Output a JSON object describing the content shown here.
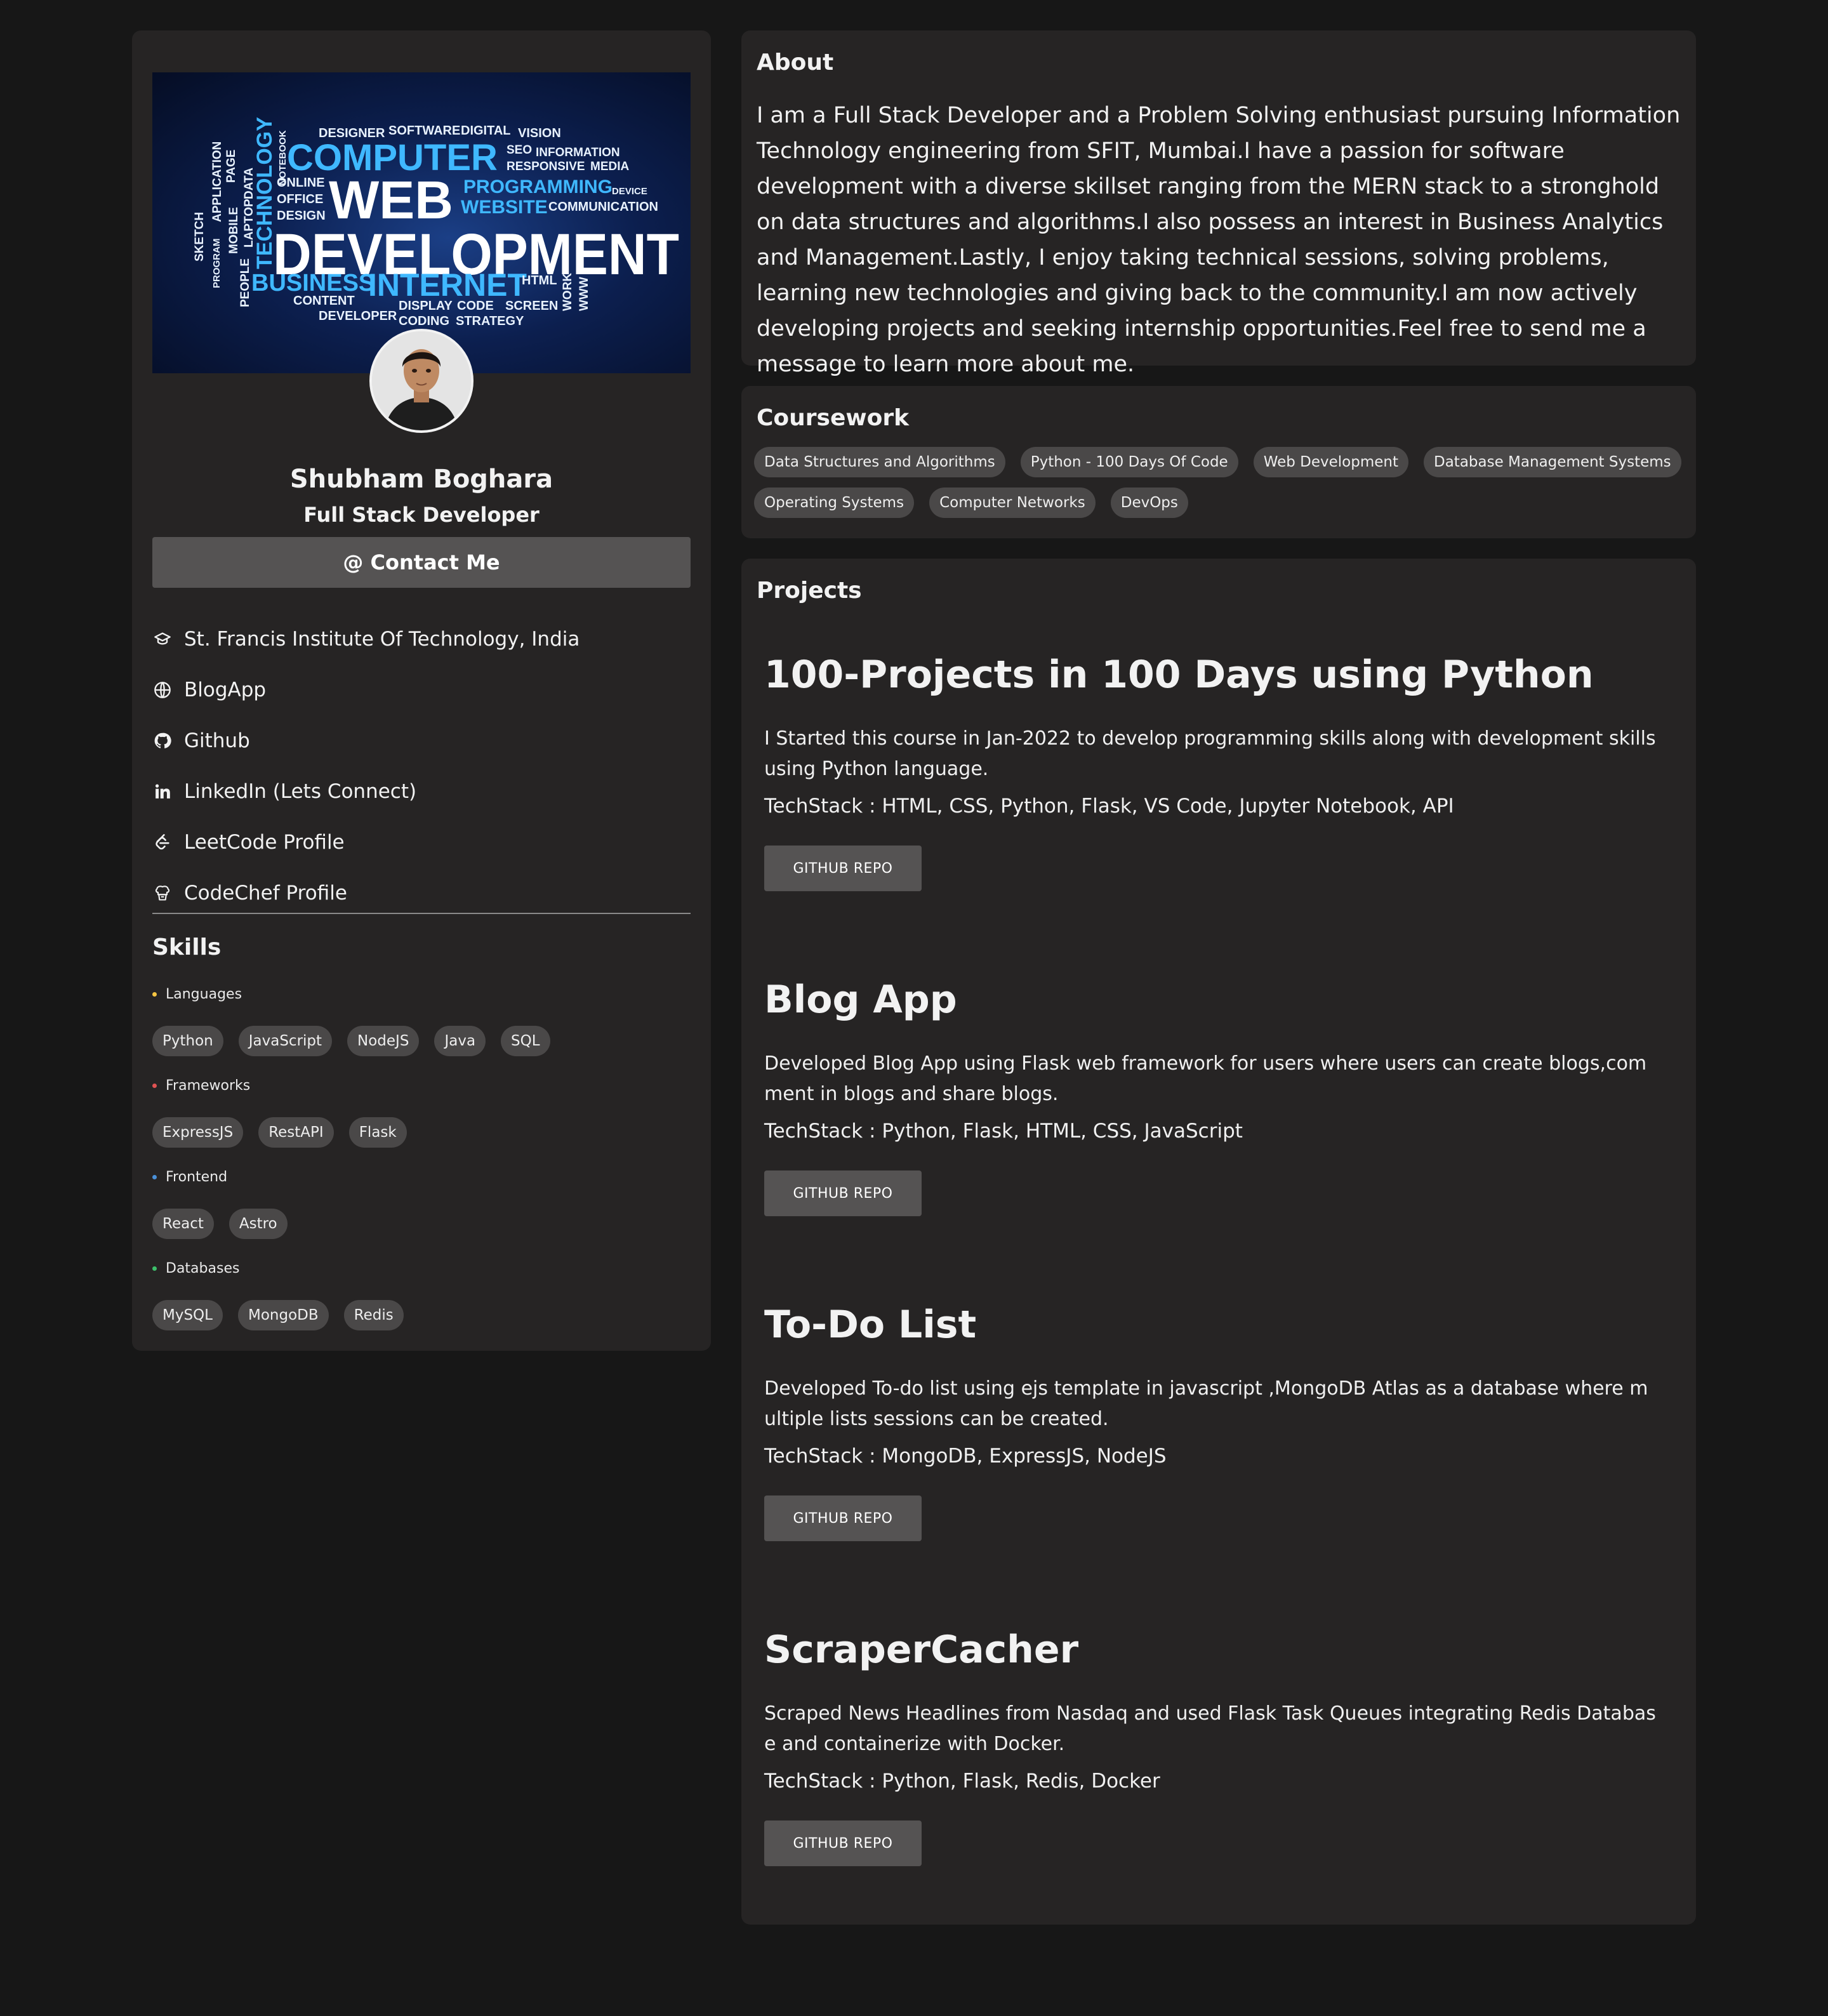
{
  "profile": {
    "name": "Shubham Boghara",
    "role": "Full Stack Developer",
    "contact_label": "@ Contact Me"
  },
  "banner": {
    "words": [
      "DESIGNER",
      "SOFTWARE",
      "DIGITAL",
      "VISION",
      "COMPUTER",
      "SEO",
      "INFORMATION",
      "RESPONSIVE",
      "MEDIA",
      "WEB",
      "PROGRAMMING",
      "DEVICE",
      "WEBSITE",
      "COMMUNICATION",
      "ONLINE",
      "OFFICE",
      "DESIGN",
      "DEVELOPMENT",
      "BUSINESS",
      "INTERNET",
      "HTML",
      "CONTENT",
      "DISPLAY",
      "CODE",
      "SCREEN",
      "DEVELOPER",
      "CODING",
      "STRATEGY",
      "TECHNOLOGY",
      "NOTEBOOK",
      "APPLICATION",
      "PAGE",
      "SKETCH",
      "MOBILE",
      "DATA",
      "LAPTOP",
      "PROGRAM",
      "PEOPLE",
      "WORK",
      "WWW"
    ]
  },
  "links": [
    {
      "icon": "graduation-cap-icon",
      "label": "St. Francis Institute Of Technology, India"
    },
    {
      "icon": "globe-icon",
      "label": "BlogApp"
    },
    {
      "icon": "github-icon",
      "label": "Github"
    },
    {
      "icon": "linkedin-icon",
      "label": "LinkedIn (Lets Connect)"
    },
    {
      "icon": "leetcode-icon",
      "label": "LeetCode Profile"
    },
    {
      "icon": "codechef-icon",
      "label": "CodeChef Profile"
    }
  ],
  "skills": {
    "title": "Skills",
    "categories": [
      {
        "name": "Languages",
        "color": "#f5c542",
        "items": [
          "Python",
          "JavaScript",
          "NodeJS",
          "Java",
          "SQL"
        ]
      },
      {
        "name": "Frameworks",
        "color": "#e05252",
        "items": [
          "ExpressJS",
          "RestAPI",
          "Flask"
        ]
      },
      {
        "name": "Frontend",
        "color": "#4a90d9",
        "items": [
          "React",
          "Astro"
        ]
      },
      {
        "name": "Databases",
        "color": "#3cbf6a",
        "items": [
          "MySQL",
          "MongoDB",
          "Redis"
        ]
      }
    ]
  },
  "about": {
    "title": "About",
    "text": "I am a Full Stack Developer and a Problem Solving enthusiast pursuing Information Technology engineering from SFIT, Mumbai.I have a passion for software development with a diverse skillset ranging from the MERN stack to a stronghold on data structures and algorithms.I also possess an interest in Business Analytics and Management.Lastly, I enjoy taking technical sessions, solving problems, learning new technologies and giving back to the community.I am now actively developing projects and seeking internship opportunities.Feel free to send me a message to learn more about me."
  },
  "coursework": {
    "title": "Coursework",
    "items": [
      "Data Structures and Algorithms",
      "Python - 100 Days Of Code",
      "Web Development",
      "Database Management Systems",
      "Operating Systems",
      "Computer Networks",
      "DevOps"
    ]
  },
  "projects": {
    "title": "Projects",
    "items": [
      {
        "title": "100-Projects in 100 Days using Python",
        "description": "I Started this course in Jan-2022 to develop programming skills along with development skills using Python language.",
        "stack": "TechStack : HTML, CSS, Python, Flask, VS Code, Jupyter Notebook, API",
        "button": "GITHUB REPO"
      },
      {
        "title": "Blog App",
        "description": "Developed Blog App using Flask web framework for users where users can create blogs,comment in blogs and share blogs.",
        "stack": "TechStack : Python, Flask, HTML, CSS, JavaScript",
        "button": "GITHUB REPO"
      },
      {
        "title": "To-Do List",
        "description": "Developed To-do list using ejs template in javascript ,MongoDB Atlas as a database where multiple lists sessions can be created.",
        "stack": "TechStack : MongoDB, ExpressJS, NodeJS",
        "button": "GITHUB REPO"
      },
      {
        "title": "ScraperCacher",
        "description": "Scraped News Headlines from Nasdaq and used Flask Task Queues integrating Redis Database and containerize with Docker.",
        "stack": "TechStack : Python, Flask, Redis, Docker",
        "button": "GITHUB REPO"
      }
    ]
  }
}
